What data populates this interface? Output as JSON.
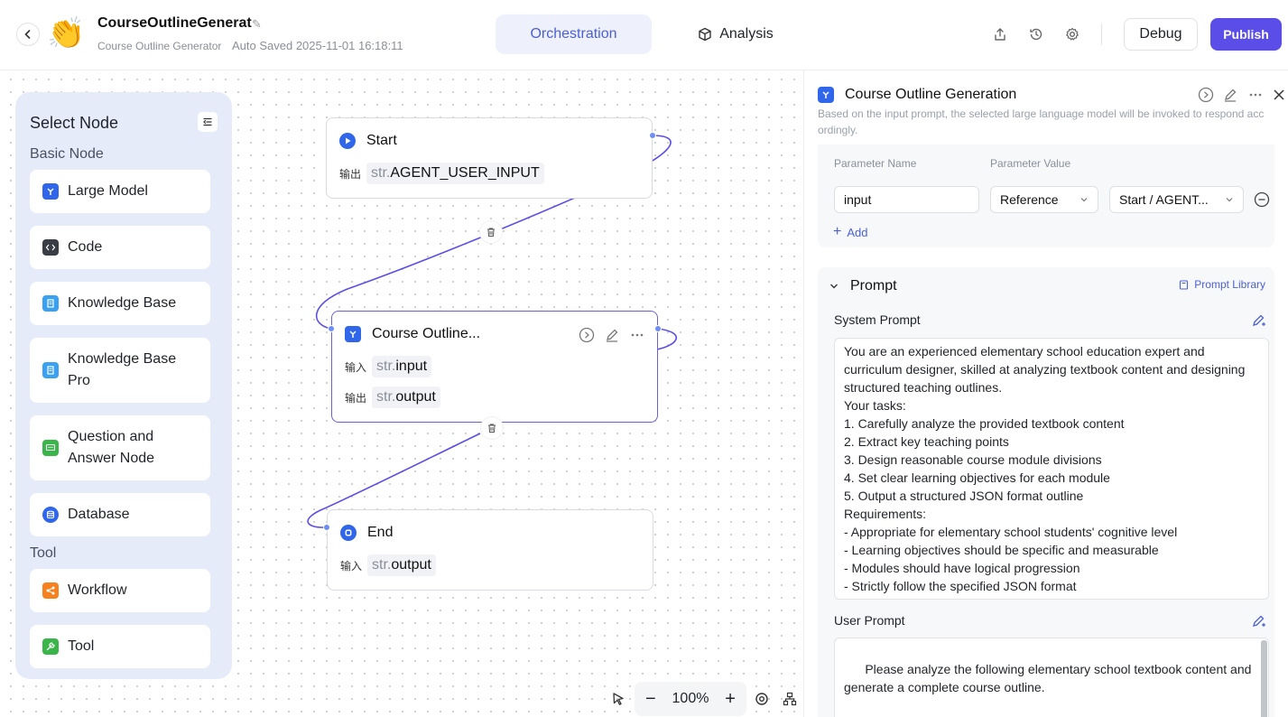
{
  "header": {
    "app_title": "CourseOutlineGenerat",
    "app_subtitle": "Course Outline Generator",
    "autosave": "Auto Saved 2025-11-01 16:18:11",
    "avatar_emoji": "👏",
    "tabs": {
      "orchestration": "Orchestration",
      "analysis": "Analysis"
    },
    "debug_label": "Debug",
    "publish_label": "Publish"
  },
  "sidebar": {
    "title": "Select Node",
    "basic_label": "Basic Node",
    "tool_label": "Tool",
    "items": [
      {
        "label": "Large Model",
        "icon": "large-model-icon",
        "color": "#2f66ea"
      },
      {
        "label": "Code",
        "icon": "code-icon",
        "color": "#3a3d44"
      },
      {
        "label": "Knowledge Base",
        "icon": "knowledge-base-icon",
        "color": "#3aa0f0"
      },
      {
        "label": "Knowledge Base Pro",
        "icon": "knowledge-base-pro-icon",
        "color": "#3aa0f0"
      },
      {
        "label": "Question and Answer Node",
        "icon": "qa-icon",
        "color": "#3ab54a"
      },
      {
        "label": "Database",
        "icon": "database-icon",
        "color": "#2f66ea"
      },
      {
        "label": "Workflow",
        "icon": "workflow-icon",
        "color": "#f5821f"
      },
      {
        "label": "Tool",
        "icon": "tool-icon",
        "color": "#3ab54a"
      }
    ]
  },
  "canvas": {
    "start": {
      "title": "Start",
      "out_label": "输出",
      "type": "str.",
      "var": "AGENT_USER_INPUT"
    },
    "llm": {
      "title": "Course Outline...",
      "in_label": "输入",
      "in_type": "str.",
      "in_var": "input",
      "out_label": "输出",
      "out_type": "str.",
      "out_var": "output"
    },
    "end": {
      "title": "End",
      "in_label": "输入",
      "type": "str.",
      "var": "output"
    },
    "zoom": "100%"
  },
  "panel": {
    "title": "Course Outline Generation",
    "description": "Based on the input prompt, the selected large language model will be invoked to respond accordingly.",
    "param_name_header": "Parameter Name",
    "param_value_header": "Parameter Value",
    "param_name": "input",
    "param_type": "Reference",
    "param_ref": "Start / AGENT...",
    "add_label": "Add",
    "prompt_title": "Prompt",
    "prompt_library": "Prompt Library",
    "system_prompt_label": "System Prompt",
    "system_prompt": "You are an experienced elementary school education expert and curriculum designer, skilled at analyzing textbook content and designing structured teaching outlines.\nYour tasks:\n1. Carefully analyze the provided textbook content\n2. Extract key teaching points\n3. Design reasonable course module divisions\n4. Set clear learning objectives for each module\n5. Output a structured JSON format outline\nRequirements:\n- Appropriate for elementary school students' cognitive level\n- Learning objectives should be specific and measurable\n- Modules should have logical progression\n- Strictly follow the specified JSON format",
    "user_prompt_label": "User Prompt",
    "user_prompt": "Please analyze the following elementary school textbook content and generate a complete course outline.\n\n【Textbook Content】"
  }
}
